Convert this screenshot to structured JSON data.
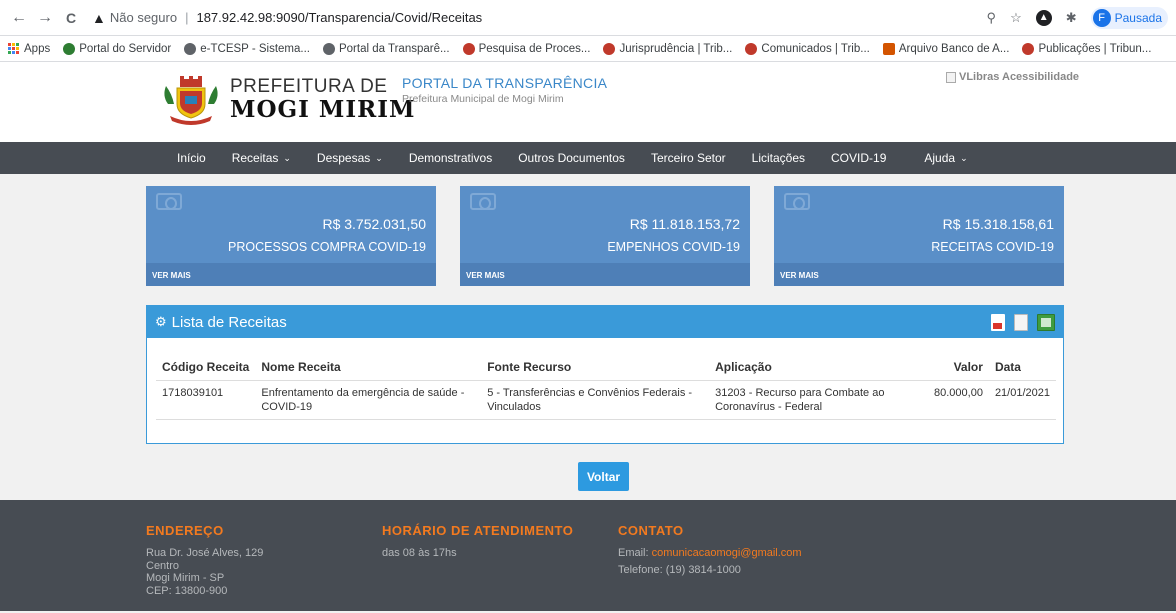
{
  "browser": {
    "back": "←",
    "forward": "→",
    "reload": "C",
    "security_label": "Não seguro",
    "url": "187.92.42.98:9090/Transparencia/Covid/Receitas",
    "profile_initial": "F",
    "profile_status": "Pausada"
  },
  "bookmarks": [
    {
      "label": "Apps"
    },
    {
      "label": "Portal do Servidor"
    },
    {
      "label": "e-TCESP - Sistema..."
    },
    {
      "label": "Portal da Transparê..."
    },
    {
      "label": "Pesquisa de Proces..."
    },
    {
      "label": "Jurisprudência | Trib..."
    },
    {
      "label": "Comunicados | Trib..."
    },
    {
      "label": "Arquivo Banco de A..."
    },
    {
      "label": "Publicações | Tribun..."
    }
  ],
  "header": {
    "logo_line1": "PREFEITURA DE",
    "logo_line2": "MOGI MIRIM",
    "portal_title": "PORTAL DA TRANSPARÊNCIA",
    "portal_subtitle": "Prefeitura Municipal de Mogi Mirim",
    "accessibility": "VLibras Acessibilidade"
  },
  "nav": [
    {
      "label": "Início",
      "dropdown": false
    },
    {
      "label": "Receitas",
      "dropdown": true
    },
    {
      "label": "Despesas",
      "dropdown": true
    },
    {
      "label": "Demonstrativos",
      "dropdown": false
    },
    {
      "label": "Outros Documentos",
      "dropdown": false
    },
    {
      "label": "Terceiro Setor",
      "dropdown": false
    },
    {
      "label": "Licitações",
      "dropdown": false
    },
    {
      "label": "COVID-19",
      "dropdown": false
    },
    {
      "label": "Ajuda",
      "dropdown": true
    }
  ],
  "cards": [
    {
      "value": "R$ 3.752.031,50",
      "label": "PROCESSOS COMPRA COVID-19",
      "more": "VER MAIS"
    },
    {
      "value": "R$ 11.818.153,72",
      "label": "EMPENHOS COVID-19",
      "more": "VER MAIS"
    },
    {
      "value": "R$ 15.318.158,61",
      "label": "RECEITAS COVID-19",
      "more": "VER MAIS"
    }
  ],
  "panel": {
    "title": "Lista de Receitas",
    "columns": [
      "Código Receita",
      "Nome Receita",
      "Fonte Recurso",
      "Aplicação",
      "Valor",
      "Data"
    ],
    "rows": [
      [
        "1718039101",
        "Enfrentamento da emergência de saúde - COVID-19",
        "5 - Transferências e Convênios Federais - Vinculados",
        "31203 - Recurso para Combate ao Coronavírus - Federal",
        "80.000,00",
        "21/01/2021"
      ]
    ]
  },
  "back_button": "Voltar",
  "footer": {
    "address_title": "ENDEREÇO",
    "address_lines": [
      "Rua Dr. José Alves, 129",
      "Centro",
      "Mogi Mirim - SP",
      "CEP: 13800-900"
    ],
    "hours_title": "HORÁRIO DE ATENDIMENTO",
    "hours_text": "das 08 às 17hs",
    "contact_title": "CONTATO",
    "email_label": "Email:",
    "email": "comunicacaomogi@gmail.com",
    "phone": "Telefone: (19) 3814-1000"
  },
  "colors": {
    "nav_bg": "#474c53",
    "card_bg": "#5a8fc8",
    "panel_head": "#3a9ad9",
    "footer_accent": "#f37a1f"
  }
}
